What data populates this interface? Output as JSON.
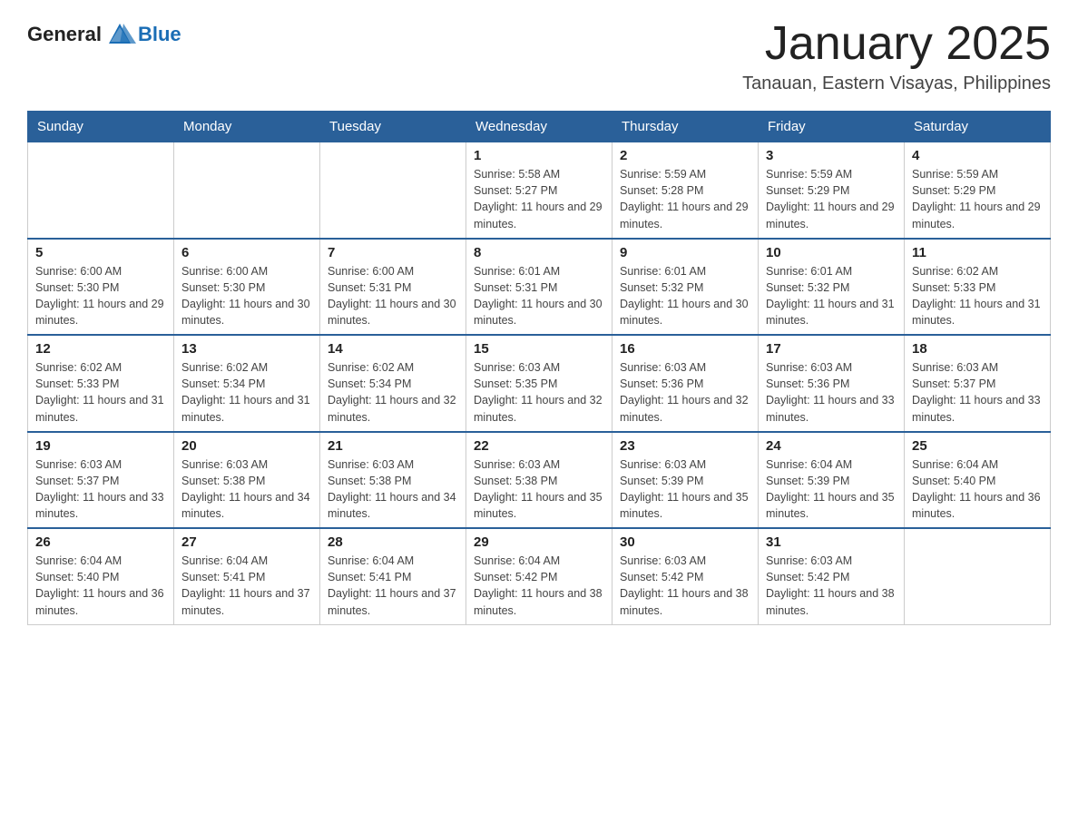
{
  "header": {
    "logo_general": "General",
    "logo_blue": "Blue",
    "month_year": "January 2025",
    "location": "Tanauan, Eastern Visayas, Philippines"
  },
  "days_of_week": [
    "Sunday",
    "Monday",
    "Tuesday",
    "Wednesday",
    "Thursday",
    "Friday",
    "Saturday"
  ],
  "weeks": [
    [
      {
        "day": "",
        "sunrise": "",
        "sunset": "",
        "daylight": ""
      },
      {
        "day": "",
        "sunrise": "",
        "sunset": "",
        "daylight": ""
      },
      {
        "day": "",
        "sunrise": "",
        "sunset": "",
        "daylight": ""
      },
      {
        "day": "1",
        "sunrise": "Sunrise: 5:58 AM",
        "sunset": "Sunset: 5:27 PM",
        "daylight": "Daylight: 11 hours and 29 minutes."
      },
      {
        "day": "2",
        "sunrise": "Sunrise: 5:59 AM",
        "sunset": "Sunset: 5:28 PM",
        "daylight": "Daylight: 11 hours and 29 minutes."
      },
      {
        "day": "3",
        "sunrise": "Sunrise: 5:59 AM",
        "sunset": "Sunset: 5:29 PM",
        "daylight": "Daylight: 11 hours and 29 minutes."
      },
      {
        "day": "4",
        "sunrise": "Sunrise: 5:59 AM",
        "sunset": "Sunset: 5:29 PM",
        "daylight": "Daylight: 11 hours and 29 minutes."
      }
    ],
    [
      {
        "day": "5",
        "sunrise": "Sunrise: 6:00 AM",
        "sunset": "Sunset: 5:30 PM",
        "daylight": "Daylight: 11 hours and 29 minutes."
      },
      {
        "day": "6",
        "sunrise": "Sunrise: 6:00 AM",
        "sunset": "Sunset: 5:30 PM",
        "daylight": "Daylight: 11 hours and 30 minutes."
      },
      {
        "day": "7",
        "sunrise": "Sunrise: 6:00 AM",
        "sunset": "Sunset: 5:31 PM",
        "daylight": "Daylight: 11 hours and 30 minutes."
      },
      {
        "day": "8",
        "sunrise": "Sunrise: 6:01 AM",
        "sunset": "Sunset: 5:31 PM",
        "daylight": "Daylight: 11 hours and 30 minutes."
      },
      {
        "day": "9",
        "sunrise": "Sunrise: 6:01 AM",
        "sunset": "Sunset: 5:32 PM",
        "daylight": "Daylight: 11 hours and 30 minutes."
      },
      {
        "day": "10",
        "sunrise": "Sunrise: 6:01 AM",
        "sunset": "Sunset: 5:32 PM",
        "daylight": "Daylight: 11 hours and 31 minutes."
      },
      {
        "day": "11",
        "sunrise": "Sunrise: 6:02 AM",
        "sunset": "Sunset: 5:33 PM",
        "daylight": "Daylight: 11 hours and 31 minutes."
      }
    ],
    [
      {
        "day": "12",
        "sunrise": "Sunrise: 6:02 AM",
        "sunset": "Sunset: 5:33 PM",
        "daylight": "Daylight: 11 hours and 31 minutes."
      },
      {
        "day": "13",
        "sunrise": "Sunrise: 6:02 AM",
        "sunset": "Sunset: 5:34 PM",
        "daylight": "Daylight: 11 hours and 31 minutes."
      },
      {
        "day": "14",
        "sunrise": "Sunrise: 6:02 AM",
        "sunset": "Sunset: 5:34 PM",
        "daylight": "Daylight: 11 hours and 32 minutes."
      },
      {
        "day": "15",
        "sunrise": "Sunrise: 6:03 AM",
        "sunset": "Sunset: 5:35 PM",
        "daylight": "Daylight: 11 hours and 32 minutes."
      },
      {
        "day": "16",
        "sunrise": "Sunrise: 6:03 AM",
        "sunset": "Sunset: 5:36 PM",
        "daylight": "Daylight: 11 hours and 32 minutes."
      },
      {
        "day": "17",
        "sunrise": "Sunrise: 6:03 AM",
        "sunset": "Sunset: 5:36 PM",
        "daylight": "Daylight: 11 hours and 33 minutes."
      },
      {
        "day": "18",
        "sunrise": "Sunrise: 6:03 AM",
        "sunset": "Sunset: 5:37 PM",
        "daylight": "Daylight: 11 hours and 33 minutes."
      }
    ],
    [
      {
        "day": "19",
        "sunrise": "Sunrise: 6:03 AM",
        "sunset": "Sunset: 5:37 PM",
        "daylight": "Daylight: 11 hours and 33 minutes."
      },
      {
        "day": "20",
        "sunrise": "Sunrise: 6:03 AM",
        "sunset": "Sunset: 5:38 PM",
        "daylight": "Daylight: 11 hours and 34 minutes."
      },
      {
        "day": "21",
        "sunrise": "Sunrise: 6:03 AM",
        "sunset": "Sunset: 5:38 PM",
        "daylight": "Daylight: 11 hours and 34 minutes."
      },
      {
        "day": "22",
        "sunrise": "Sunrise: 6:03 AM",
        "sunset": "Sunset: 5:38 PM",
        "daylight": "Daylight: 11 hours and 35 minutes."
      },
      {
        "day": "23",
        "sunrise": "Sunrise: 6:03 AM",
        "sunset": "Sunset: 5:39 PM",
        "daylight": "Daylight: 11 hours and 35 minutes."
      },
      {
        "day": "24",
        "sunrise": "Sunrise: 6:04 AM",
        "sunset": "Sunset: 5:39 PM",
        "daylight": "Daylight: 11 hours and 35 minutes."
      },
      {
        "day": "25",
        "sunrise": "Sunrise: 6:04 AM",
        "sunset": "Sunset: 5:40 PM",
        "daylight": "Daylight: 11 hours and 36 minutes."
      }
    ],
    [
      {
        "day": "26",
        "sunrise": "Sunrise: 6:04 AM",
        "sunset": "Sunset: 5:40 PM",
        "daylight": "Daylight: 11 hours and 36 minutes."
      },
      {
        "day": "27",
        "sunrise": "Sunrise: 6:04 AM",
        "sunset": "Sunset: 5:41 PM",
        "daylight": "Daylight: 11 hours and 37 minutes."
      },
      {
        "day": "28",
        "sunrise": "Sunrise: 6:04 AM",
        "sunset": "Sunset: 5:41 PM",
        "daylight": "Daylight: 11 hours and 37 minutes."
      },
      {
        "day": "29",
        "sunrise": "Sunrise: 6:04 AM",
        "sunset": "Sunset: 5:42 PM",
        "daylight": "Daylight: 11 hours and 38 minutes."
      },
      {
        "day": "30",
        "sunrise": "Sunrise: 6:03 AM",
        "sunset": "Sunset: 5:42 PM",
        "daylight": "Daylight: 11 hours and 38 minutes."
      },
      {
        "day": "31",
        "sunrise": "Sunrise: 6:03 AM",
        "sunset": "Sunset: 5:42 PM",
        "daylight": "Daylight: 11 hours and 38 minutes."
      },
      {
        "day": "",
        "sunrise": "",
        "sunset": "",
        "daylight": ""
      }
    ]
  ]
}
